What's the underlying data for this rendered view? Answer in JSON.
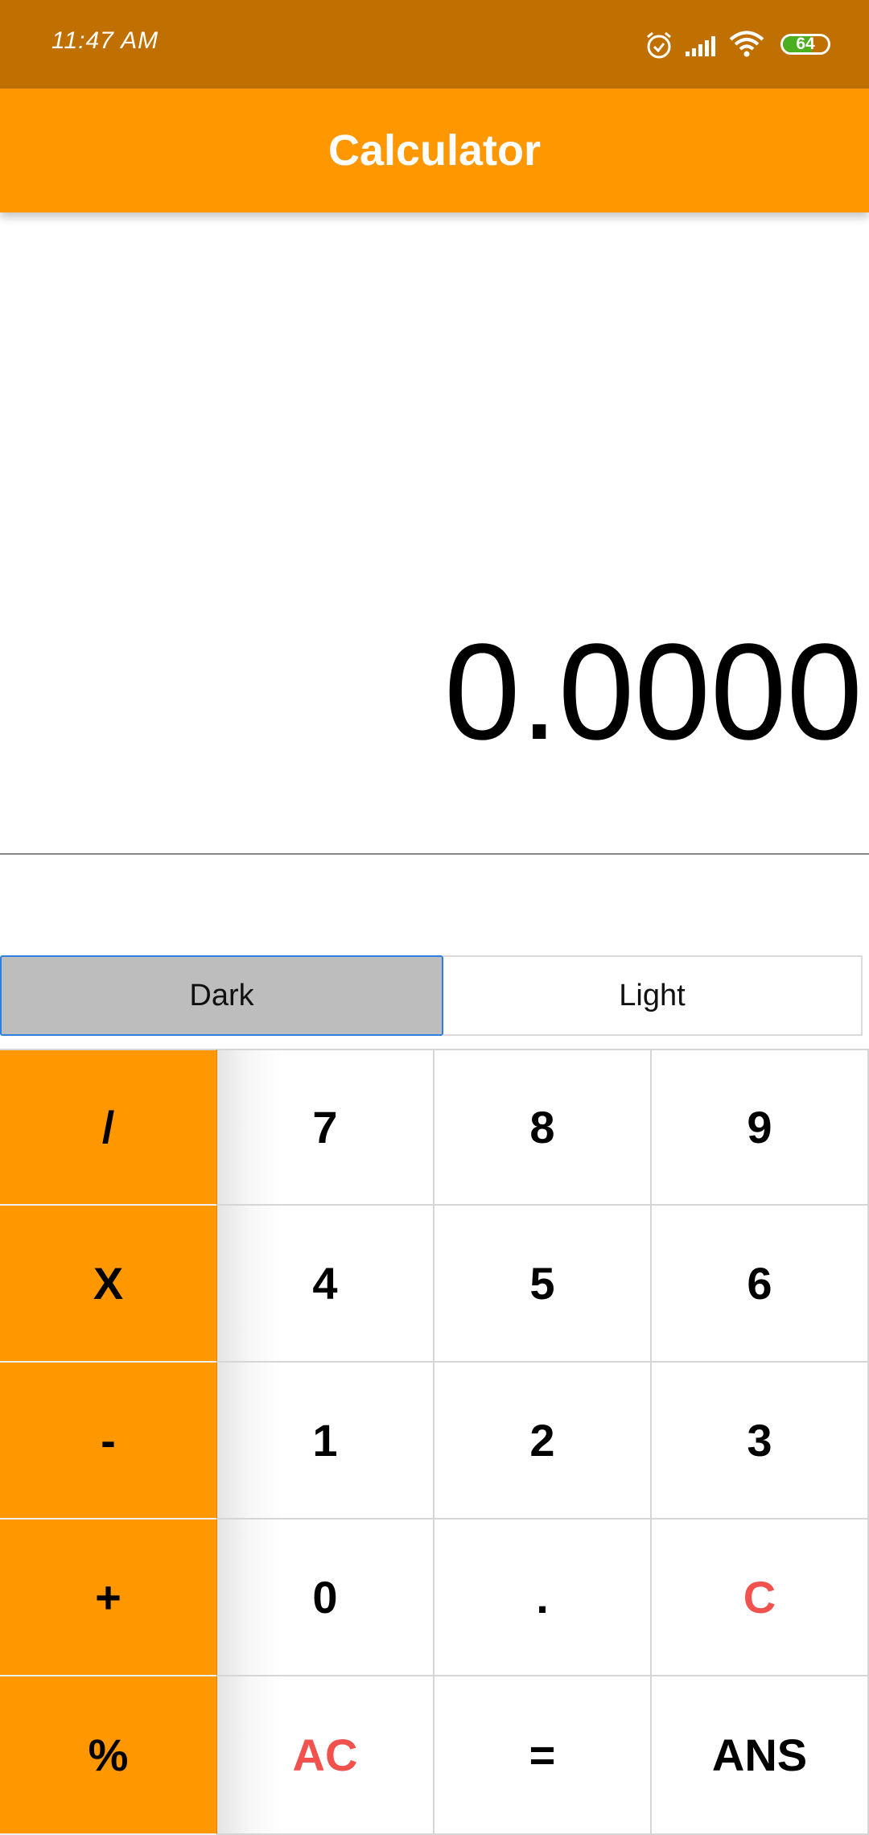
{
  "status_bar": {
    "time": "11:47 AM",
    "battery": "64",
    "icons": [
      "alarm-icon",
      "signal-icon",
      "wifi-icon",
      "battery-icon"
    ],
    "color": "#BF7000"
  },
  "app_bar": {
    "title": "Calculator",
    "color": "#FF9800"
  },
  "display": {
    "value": "0.0000"
  },
  "theme_toggle": {
    "dark_label": "Dark",
    "light_label": "Light",
    "selected": "Dark"
  },
  "keypad": {
    "keys": [
      [
        "/",
        "7",
        "8",
        "9"
      ],
      [
        "X",
        "4",
        "5",
        "6"
      ],
      [
        "-",
        "1",
        "2",
        "3"
      ],
      [
        "+",
        "0",
        ".",
        "C"
      ],
      [
        "%",
        "AC",
        "=",
        "ANS"
      ]
    ]
  },
  "colors": {
    "operator": "#FF9800",
    "clear_text": "#F2524E",
    "selected_border": "#2F7FE0"
  }
}
